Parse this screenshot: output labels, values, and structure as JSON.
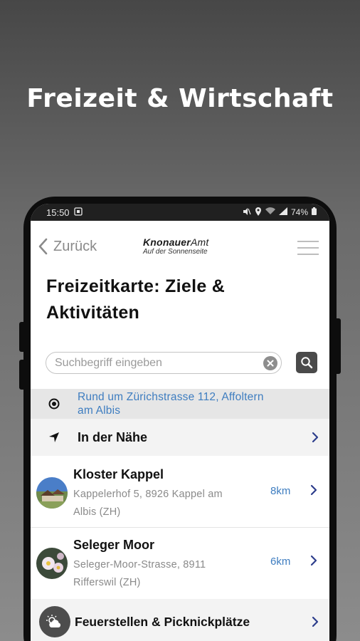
{
  "headline": "Freizeit & Wirtschaft",
  "status": {
    "time": "15:50",
    "battery": "74%"
  },
  "nav": {
    "back_label": "Zurück",
    "logo_line1_bold": "Knonauer",
    "logo_line1_thin": "Amt",
    "logo_line2": "Auf der Sonnenseite"
  },
  "page": {
    "title_line1": "Freizeitkarte: Ziele &",
    "title_line2": "Aktivitäten"
  },
  "search": {
    "placeholder": "Suchbegriff eingeben"
  },
  "location": {
    "line1": "Rund um Zürichstrasse 112, Affoltern",
    "line2": "am Albis"
  },
  "nearby": {
    "label": "In der Nähe"
  },
  "places": [
    {
      "name": "Kloster Kappel",
      "address_line1": "Kappelerhof 5, 8926 Kappel am",
      "address_line2": "Albis (ZH)",
      "distance": "8km"
    },
    {
      "name": "Seleger Moor",
      "address_line1": "Seleger-Moor-Strasse, 8911",
      "address_line2": "Rifferswil (ZH)",
      "distance": "6km"
    }
  ],
  "category": {
    "label": "Feuerstellen & Picknickplätze"
  },
  "colors": {
    "accent_blue": "#3e7dc0",
    "phone_frame": "#0d0d0d",
    "status_bar": "#202020"
  }
}
